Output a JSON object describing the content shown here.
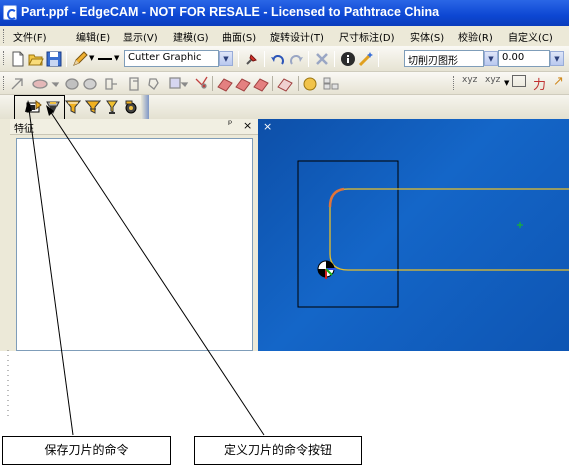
{
  "window": {
    "title": "Part.ppf - EdgeCAM - NOT FOR RESALE - Licensed to Pathtrace China"
  },
  "menu": [
    {
      "label": "文件(F)"
    },
    {
      "label": "编辑(E)"
    },
    {
      "label": "显示(V)"
    },
    {
      "label": "建模(G)"
    },
    {
      "label": "曲面(S)"
    },
    {
      "label": "旋转设计(T)"
    },
    {
      "label": "尺寸标注(D)"
    },
    {
      "label": "实体(S)"
    },
    {
      "label": "校验(R)"
    },
    {
      "label": "自定义(C)"
    }
  ],
  "toolbar1": {
    "line_style_combo": "Cutter Graphic",
    "mode_combo": "切削刃图形",
    "value_combo": "0.00"
  },
  "toolbar3": {
    "icons": [
      "save-blade-icon",
      "define-blade-icon",
      "funnel-icon",
      "funnel-icon",
      "funnel-small-icon",
      "blade-settings-icon"
    ]
  },
  "feature_panel": {
    "title": "特征",
    "pin_glyph": "ᵖ",
    "close_glyph": "×"
  },
  "viewport": {
    "close_glyph": "×",
    "profile_color": "#e8c02a",
    "highlight_color": "#e0743a",
    "marker_color": "#19c219",
    "background": "#1262c2"
  },
  "annotations": {
    "save_blade": "保存刀片的命令",
    "define_blade": "定义刀片的命令按钮"
  }
}
